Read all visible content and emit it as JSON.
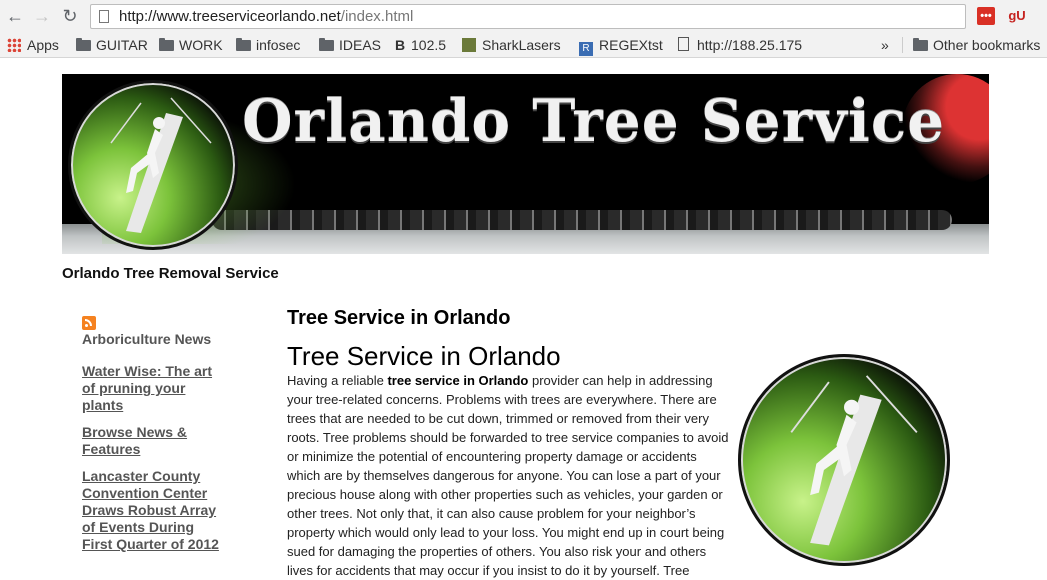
{
  "browser": {
    "url_host": "http://www.treeserviceorlando.net",
    "url_path": "/index.html",
    "ext_left": "•••",
    "ext_right": "gU"
  },
  "bookmarks": [
    {
      "label": "Apps",
      "icon": "apps-grid-icon"
    },
    {
      "label": "GUITAR",
      "icon": "folder-icon"
    },
    {
      "label": "WORK",
      "icon": "folder-icon"
    },
    {
      "label": "infosec",
      "icon": "folder-icon"
    },
    {
      "label": "IDEAS",
      "icon": "folder-icon"
    },
    {
      "label": "102.5",
      "icon": "b-icon"
    },
    {
      "label": "SharkLasers",
      "icon": "sharklasers-icon"
    },
    {
      "label": "REGEXtst",
      "icon": "r-icon"
    },
    {
      "label": "http://188.25.175",
      "icon": "page-icon"
    },
    {
      "label": "»",
      "icon": "overflow-icon"
    },
    {
      "label": "Other bookmarks",
      "icon": "folder-icon"
    }
  ],
  "banner": {
    "title": "Orlando Tree Service"
  },
  "site": {
    "tagline": "Orlando Tree Removal Service",
    "sidebar_title": "Arboriculture News",
    "news": [
      "Water Wise: The art of pruning your plants",
      "Browse News & Features",
      "Lancaster County Convention Center Draws Robust Array of Events During First Quarter of 2012"
    ],
    "section_title": "Tree Service in Orlando",
    "heading": "Tree Service in Orlando",
    "para_start": "Having a reliable ",
    "para_bold": "tree service in Orlando",
    "para_rest": " provider can help in addressing your tree-related concerns. Problems with trees are everywhere. There are trees that are needed to be cut down, trimmed or removed from their very roots. Tree problems should be forwarded to tree service companies to avoid or minimize the potential of encountering property damage or accidents which are by themselves dangerous for anyone. You can lose a part of your precious house along with other properties such as vehicles, your garden or other trees. Not only that, it can also cause problem for your neighbor’s property which would only lead to your loss. You might end up in court being sued for damaging the properties of others. You also risk your and others lives for accidents that may occur if you insist to do it by yourself. Tree"
  },
  "colors": {
    "accent_green": "#7cc33b",
    "rss_orange": "#f58220"
  }
}
